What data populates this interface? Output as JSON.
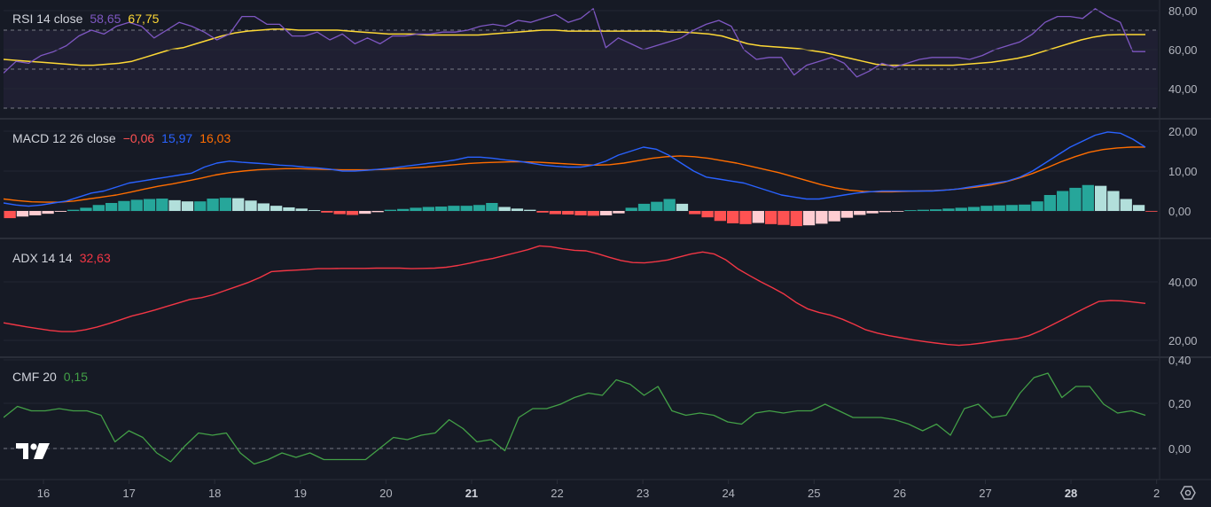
{
  "colors": {
    "background": "#161a25",
    "separator": "#2a2e39",
    "grid": "#232734",
    "text": "#d1d4dc",
    "axis_text": "#b2b5be",
    "rsi": "#7e57c2",
    "rsi_ma": "#fdd835",
    "macd": "#2962ff",
    "signal": "#ff6d00",
    "hist_pos_strong": "#26a69a",
    "hist_pos_weak": "#b2dfdb",
    "hist_neg_strong": "#ff5252",
    "hist_neg_weak": "#ffcdd2",
    "adx": "#f23645",
    "cmf": "#43a047",
    "watermark": "#ffffff"
  },
  "logo": {
    "text": "TV",
    "icon": "tradingview-logo-icon"
  },
  "settings": {
    "icon": "gear-icon"
  },
  "chart_data": [
    {
      "type": "line",
      "title": "RSI 14 close",
      "legend_values": [
        "58,65",
        "67,75"
      ],
      "y_ticks": [
        "80,00",
        "60,00",
        "40,00"
      ],
      "ylim": [
        28,
        85
      ],
      "bands": [
        30,
        50,
        70
      ],
      "series": [
        {
          "values": [
            48,
            54,
            53,
            57,
            59,
            62,
            67,
            70,
            68,
            72,
            74,
            72,
            66,
            70,
            74,
            72,
            69,
            65,
            68,
            77,
            77,
            73,
            73,
            67,
            67,
            69,
            65,
            68,
            63,
            66,
            63,
            67,
            67,
            68,
            68,
            69,
            69,
            70,
            72,
            73,
            72,
            75,
            74,
            76,
            78,
            74,
            76,
            81,
            61,
            66,
            63,
            60,
            62,
            64,
            66,
            70,
            73,
            75,
            72,
            60,
            55,
            56,
            56,
            47,
            52,
            54,
            56,
            53,
            46,
            49,
            53,
            51,
            53,
            55,
            56,
            56,
            56,
            55,
            57,
            60,
            62,
            64,
            68,
            74,
            77,
            77,
            76,
            81,
            77,
            74,
            59,
            59
          ]
        },
        {
          "values": [
            55,
            54.5,
            54,
            53.5,
            53,
            52.5,
            52,
            52,
            52.5,
            53,
            54,
            56,
            58,
            60,
            61,
            63,
            65,
            67,
            68.5,
            69.5,
            70,
            70.5,
            70.5,
            70,
            70,
            70,
            70,
            69.5,
            69,
            68.5,
            68,
            68,
            68,
            67.5,
            67.5,
            67.5,
            67.5,
            67.5,
            68,
            68.5,
            69,
            69.5,
            70,
            70,
            69.5,
            69.5,
            69.5,
            69.5,
            69.5,
            69.5,
            69.5,
            69.5,
            69,
            69,
            68.5,
            68,
            67,
            65,
            63,
            62,
            61.5,
            61,
            60.5,
            59.5,
            58.5,
            57,
            55.5,
            54,
            52.5,
            52,
            52,
            52,
            52,
            52,
            52,
            52.5,
            53,
            53.5,
            54.5,
            55.5,
            57,
            59,
            61,
            63,
            65,
            66.5,
            67.5,
            67.75,
            67.75,
            67.75
          ]
        }
      ]
    },
    {
      "type": "line",
      "title": "MACD 12 26 close",
      "legend_values": [
        "−0,06",
        "15,97",
        "16,03"
      ],
      "y_ticks": [
        "20,00",
        "10,00",
        "0,00"
      ],
      "ylim": [
        -4.5,
        21.5
      ],
      "series": [
        {
          "values": [
            2,
            1.5,
            1.2,
            1.5,
            2,
            2.5,
            3.5,
            4.5,
            5,
            6,
            7,
            7.5,
            8,
            8.5,
            9,
            9.5,
            11,
            12,
            12.5,
            12.2,
            12,
            11.8,
            11.5,
            11.3,
            11,
            10.8,
            10.5,
            10,
            10,
            10.2,
            10.5,
            10.8,
            11.2,
            11.6,
            12,
            12.3,
            12.8,
            13.5,
            13.5,
            13.2,
            12.8,
            12.5,
            12,
            11.5,
            11.2,
            11,
            11,
            11.5,
            12.5,
            14,
            15,
            16,
            15.5,
            14,
            12,
            10,
            8.5,
            8,
            7.5,
            7,
            6,
            5,
            4,
            3.5,
            3,
            3,
            3.5,
            4,
            4.5,
            4.8,
            5,
            5,
            5,
            5,
            5,
            5.2,
            5.5,
            6,
            6.5,
            7,
            7.5,
            8.5,
            10,
            12,
            14,
            16,
            17.5,
            19,
            19.8,
            19.5,
            18,
            16
          ]
        },
        {
          "values": [
            3,
            2.6,
            2.3,
            2.2,
            2.2,
            2.5,
            3,
            3.5,
            4,
            4.7,
            5.5,
            6.2,
            6.8,
            7.5,
            8.2,
            9,
            9.6,
            10,
            10.3,
            10.5,
            10.6,
            10.6,
            10.5,
            10.4,
            10.3,
            10.3,
            10.3,
            10.4,
            10.6,
            10.8,
            11,
            11.3,
            11.6,
            11.9,
            12.1,
            12.2,
            12.3,
            12.3,
            12.2,
            12,
            11.8,
            11.6,
            11.5,
            11.6,
            12,
            12.6,
            13.2,
            13.6,
            13.8,
            13.6,
            13.2,
            12.6,
            12,
            11.2,
            10.4,
            9.6,
            8.6,
            7.6,
            6.6,
            5.8,
            5.2,
            4.9,
            4.8,
            4.8,
            4.9,
            5,
            5.1,
            5.3,
            5.6,
            6,
            6.5,
            7.2,
            8.2,
            9.4,
            10.8,
            12.3,
            13.6,
            14.7,
            15.4,
            15.8,
            16,
            16.03
          ]
        }
      ],
      "histogram": [
        -1.8,
        -1.4,
        -1.1,
        -0.7,
        -0.2,
        0.3,
        0.8,
        1.5,
        2,
        2.5,
        2.8,
        3,
        3.1,
        2.7,
        2.4,
        2.4,
        3.1,
        3.3,
        3.2,
        2.6,
        1.9,
        1.3,
        0.9,
        0.6,
        0.2,
        -0.4,
        -0.8,
        -1,
        -0.7,
        -0.3,
        0.3,
        0.5,
        0.8,
        1,
        1.1,
        1.3,
        1.3,
        1.5,
        2,
        1,
        0.6,
        0.3,
        -0.4,
        -0.8,
        -0.9,
        -1.1,
        -1.2,
        -1.1,
        -0.6,
        0.8,
        1.8,
        2.3,
        3,
        1.8,
        -0.8,
        -1.6,
        -2.5,
        -3.1,
        -3.3,
        -3,
        -3.3,
        -3.5,
        -3.8,
        -3.6,
        -3.2,
        -2.6,
        -1.7,
        -1,
        -0.6,
        -0.3,
        -0.1,
        0.2,
        0.3,
        0.4,
        0.6,
        0.8,
        1,
        1.3,
        1.4,
        1.5,
        1.6,
        2.4,
        4,
        5,
        5.8,
        6.5,
        6.3,
        5,
        3,
        1.5,
        -0.06
      ]
    },
    {
      "type": "line",
      "title": "ADX 14 14",
      "legend_values": [
        "32,63"
      ],
      "y_ticks": [
        "40,00",
        "20,00"
      ],
      "ylim": [
        14,
        60
      ],
      "series": [
        {
          "values": [
            26,
            25.3,
            24.6,
            24,
            23.4,
            23,
            23,
            23.6,
            24.5,
            25.7,
            27,
            28.3,
            29.3,
            30.4,
            31.6,
            32.8,
            34,
            34.6,
            35.6,
            37,
            38.4,
            39.8,
            41.5,
            43.5,
            43.8,
            44,
            44.2,
            44.5,
            44.5,
            44.6,
            44.6,
            44.6,
            44.7,
            44.7,
            44.7,
            44.5,
            44.6,
            44.7,
            45,
            45.6,
            46.4,
            47.3,
            48,
            49,
            50,
            51,
            52.3,
            52,
            51.3,
            50.8,
            50.6,
            49.6,
            48.4,
            47.3,
            46.6,
            46.5,
            46.9,
            47.5,
            48.5,
            49.5,
            50.2,
            49.5,
            47.5,
            44.5,
            42.2,
            40,
            38,
            35.8,
            33,
            30.8,
            29.5,
            28.6,
            27.2,
            25.5,
            23.6,
            22.5,
            21.6,
            20.9,
            20.2,
            19.6,
            19.1,
            18.6,
            18.3,
            18.6,
            19.1,
            19.7,
            20.2,
            20.6,
            21.6,
            23.3,
            25.3,
            27.3,
            29.4,
            31.4,
            33.3,
            33.6,
            33.5,
            33.1,
            32.63
          ]
        }
      ]
    },
    {
      "type": "line",
      "title": "CMF 20",
      "legend_values": [
        "0,15"
      ],
      "y_ticks": [
        "0,40",
        "0,20",
        "0,00"
      ],
      "ylim": [
        -0.09,
        0.4
      ],
      "series": [
        {
          "values": [
            0.14,
            0.19,
            0.17,
            0.17,
            0.18,
            0.17,
            0.17,
            0.15,
            0.03,
            0.08,
            0.05,
            -0.02,
            -0.06,
            0.01,
            0.07,
            0.06,
            0.07,
            -0.02,
            -0.07,
            -0.05,
            -0.02,
            -0.04,
            -0.02,
            -0.05,
            -0.05,
            -0.05,
            -0.05,
            0.0,
            0.05,
            0.04,
            0.06,
            0.07,
            0.13,
            0.09,
            0.03,
            0.04,
            -0.01,
            0.14,
            0.18,
            0.18,
            0.2,
            0.23,
            0.25,
            0.24,
            0.31,
            0.29,
            0.24,
            0.28,
            0.17,
            0.15,
            0.16,
            0.15,
            0.12,
            0.11,
            0.16,
            0.17,
            0.16,
            0.17,
            0.17,
            0.2,
            0.17,
            0.14,
            0.14,
            0.14,
            0.13,
            0.11,
            0.08,
            0.11,
            0.06,
            0.18,
            0.2,
            0.14,
            0.15,
            0.25,
            0.32,
            0.34,
            0.23,
            0.28,
            0.28,
            0.2,
            0.16,
            0.17,
            0.15
          ]
        }
      ]
    }
  ],
  "x_axis": {
    "labels": [
      {
        "text": "16",
        "bold": false
      },
      {
        "text": "17",
        "bold": false
      },
      {
        "text": "18",
        "bold": false
      },
      {
        "text": "19",
        "bold": false
      },
      {
        "text": "20",
        "bold": false
      },
      {
        "text": "21",
        "bold": true
      },
      {
        "text": "22",
        "bold": false
      },
      {
        "text": "23",
        "bold": false
      },
      {
        "text": "24",
        "bold": false
      },
      {
        "text": "25",
        "bold": false
      },
      {
        "text": "26",
        "bold": false
      },
      {
        "text": "27",
        "bold": false
      },
      {
        "text": "28",
        "bold": true
      },
      {
        "text": "2",
        "bold": false
      }
    ]
  }
}
